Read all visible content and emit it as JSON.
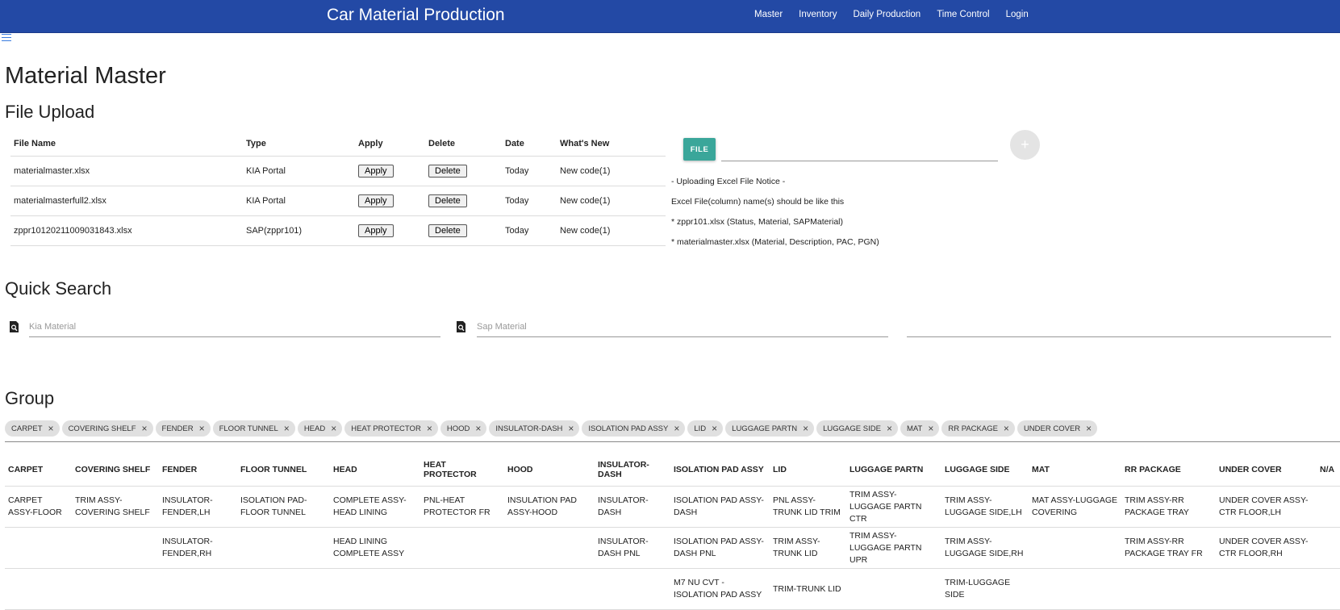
{
  "app": {
    "title": "Car Material Production",
    "nav": [
      "Master",
      "Inventory",
      "Daily Production",
      "Time Control",
      "Login"
    ]
  },
  "page": {
    "title": "Material Master"
  },
  "file_upload": {
    "title": "File Upload",
    "columns": [
      "File Name",
      "Type",
      "Apply",
      "Delete",
      "Date",
      "What's New"
    ],
    "rows": [
      {
        "name": "materialmaster.xlsx",
        "type": "KIA Portal",
        "apply": "Apply",
        "delete": "Delete",
        "date": "Today",
        "whats_new": "New code(1)"
      },
      {
        "name": "materialmasterfull2.xlsx",
        "type": "KIA Portal",
        "apply": "Apply",
        "delete": "Delete",
        "date": "Today",
        "whats_new": "New code(1)"
      },
      {
        "name": "zppr10120211009031843.xlsx",
        "type": "SAP(zppr101)",
        "apply": "Apply",
        "delete": "Delete",
        "date": "Today",
        "whats_new": "New code(1)"
      }
    ],
    "file_button": "FILE",
    "add_button": "+",
    "notice": [
      "- Uploading Excel File Notice -",
      "Excel File(column) name(s) should be like this",
      "* zppr101.xlsx (Status, Material, SAPMaterial)",
      "* materialmaster.xlsx (Material, Description, PAC, PGN)"
    ]
  },
  "quick_search": {
    "title": "Quick Search",
    "kia_placeholder": "Kia Material",
    "sap_placeholder": "Sap Material",
    "third_value": ""
  },
  "group": {
    "title": "Group",
    "chips": [
      "CARPET",
      "COVERING SHELF",
      "FENDER",
      "FLOOR TUNNEL",
      "HEAD",
      "HEAT PROTECTOR",
      "HOOD",
      "INSULATOR-DASH",
      "ISOLATION PAD ASSY",
      "LID",
      "LUGGAGE PARTN",
      "LUGGAGE SIDE",
      "MAT",
      "RR PACKAGE",
      "UNDER COVER"
    ],
    "columns": [
      "CARPET",
      "COVERING SHELF",
      "FENDER",
      "FLOOR TUNNEL",
      "HEAD",
      "HEAT PROTECTOR",
      "HOOD",
      "INSULATOR-DASH",
      "ISOLATION PAD ASSY",
      "LID",
      "LUGGAGE PARTN",
      "LUGGAGE SIDE",
      "MAT",
      "RR PACKAGE",
      "UNDER COVER",
      "N/A"
    ],
    "rows": [
      [
        "CARPET ASSY-FLOOR",
        "TRIM ASSY-COVERING SHELF",
        "INSULATOR-FENDER,LH",
        "ISOLATION PAD-FLOOR TUNNEL",
        "COMPLETE ASSY-HEAD LINING",
        "PNL-HEAT PROTECTOR FR",
        "INSULATION PAD ASSY-HOOD",
        "INSULATOR-DASH",
        "ISOLATION PAD ASSY-DASH",
        "PNL ASSY-TRUNK LID TRIM",
        "TRIM ASSY-LUGGAGE PARTN CTR",
        "TRIM ASSY-LUGGAGE SIDE,LH",
        "MAT ASSY-LUGGAGE COVERING",
        "TRIM ASSY-RR PACKAGE TRAY",
        "UNDER COVER ASSY-CTR FLOOR,LH",
        ""
      ],
      [
        "",
        "",
        "INSULATOR-FENDER,RH",
        "",
        "HEAD LINING COMPLETE ASSY",
        "",
        "",
        "INSULATOR-DASH PNL",
        "ISOLATION PAD ASSY-DASH PNL",
        "TRIM ASSY-TRUNK LID",
        "TRIM ASSY-LUGGAGE PARTN UPR",
        "TRIM ASSY-LUGGAGE SIDE,RH",
        "",
        "TRIM ASSY-RR PACKAGE TRAY FR",
        "UNDER COVER ASSY-CTR FLOOR,RH",
        ""
      ],
      [
        "",
        "",
        "",
        "",
        "",
        "",
        "",
        "",
        "M7 NU CVT - ISOLATION PAD ASSY",
        "TRIM-TRUNK LID",
        "",
        "TRIM-LUGGAGE SIDE",
        "",
        "",
        "",
        ""
      ]
    ]
  },
  "colors": {
    "header": "#2349a5",
    "file_button": "#3aa69a",
    "chip": "#e0e0e0"
  }
}
